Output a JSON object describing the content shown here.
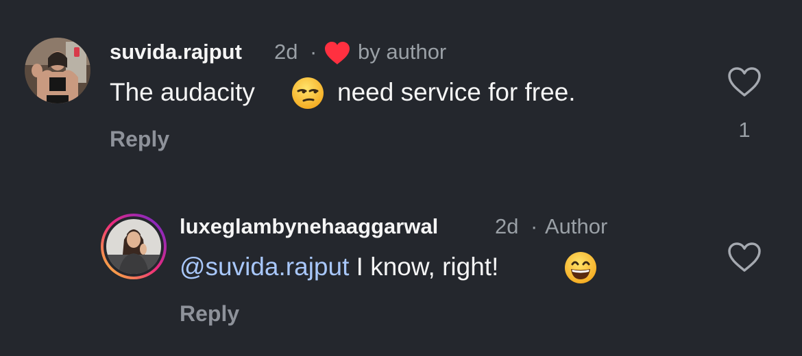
{
  "comments": [
    {
      "username": "suvida.rajput",
      "time": "2d",
      "separator": "·",
      "liked_by_author_label": "by author",
      "text_before_emoji": "The audacity",
      "emoji": "unamused-face",
      "text_after_emoji": "need service for free.",
      "reply_label": "Reply",
      "like_icon": "heart-outline-icon",
      "like_count": "1"
    },
    {
      "username": "luxeglambynehaaggarwal",
      "time": "2d",
      "separator": "·",
      "badge": "Author",
      "mention": "@suvida.rajput",
      "text": "I know, right!",
      "emoji": "grinning-face",
      "reply_label": "Reply",
      "like_icon": "heart-outline-icon"
    }
  ],
  "colors": {
    "background": "#24272d",
    "author_heart": "#ff3040",
    "mention": "#a8c7fa",
    "muted": "#9aa0a6",
    "story_ring": [
      "#f9ce34",
      "#ee2a7b",
      "#6228d7"
    ]
  }
}
